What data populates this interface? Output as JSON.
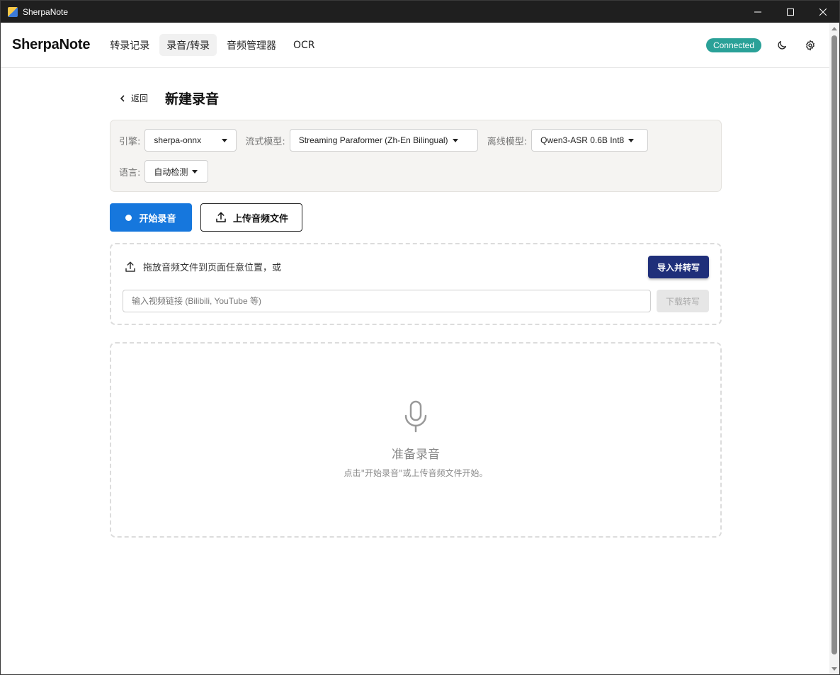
{
  "window": {
    "title": "SherpaNote",
    "minimize_glyph": "—",
    "maximize_glyph": "☐",
    "close_glyph": "✕"
  },
  "header": {
    "brand": "SherpaNote",
    "nav": [
      {
        "label": "转录记录",
        "active": false
      },
      {
        "label": "录音/转录",
        "active": true
      },
      {
        "label": "音频管理器",
        "active": false
      },
      {
        "label": "OCR",
        "active": false
      }
    ],
    "status": "Connected",
    "status_color": "#2aa198",
    "icons": [
      "moon-icon",
      "gear-icon"
    ]
  },
  "page": {
    "back_label": "返回",
    "title": "新建录音"
  },
  "config": {
    "engine_label": "引擎:",
    "engine_value": "sherpa-onnx",
    "stream_label": "流式模型:",
    "stream_value": "Streaming Paraformer (Zh-En Bilingual)",
    "offline_label": "离线模型:",
    "offline_value": "Qwen3-ASR 0.6B Int8",
    "language_label": "语言:",
    "language_value": "自动检测"
  },
  "actions": {
    "record_label": "开始录音",
    "upload_label": "上传音频文件",
    "primary_color": "#1677dd"
  },
  "drop": {
    "hint": "拖放音频文件到页面任意位置，或",
    "import_label": "导入并转写",
    "url_placeholder": "输入视频链接 (Bilibili, YouTube 等)",
    "download_label": "下载转写"
  },
  "empty": {
    "title": "准备录音",
    "subtitle": "点击\"开始录音\"或上传音频文件开始。"
  }
}
